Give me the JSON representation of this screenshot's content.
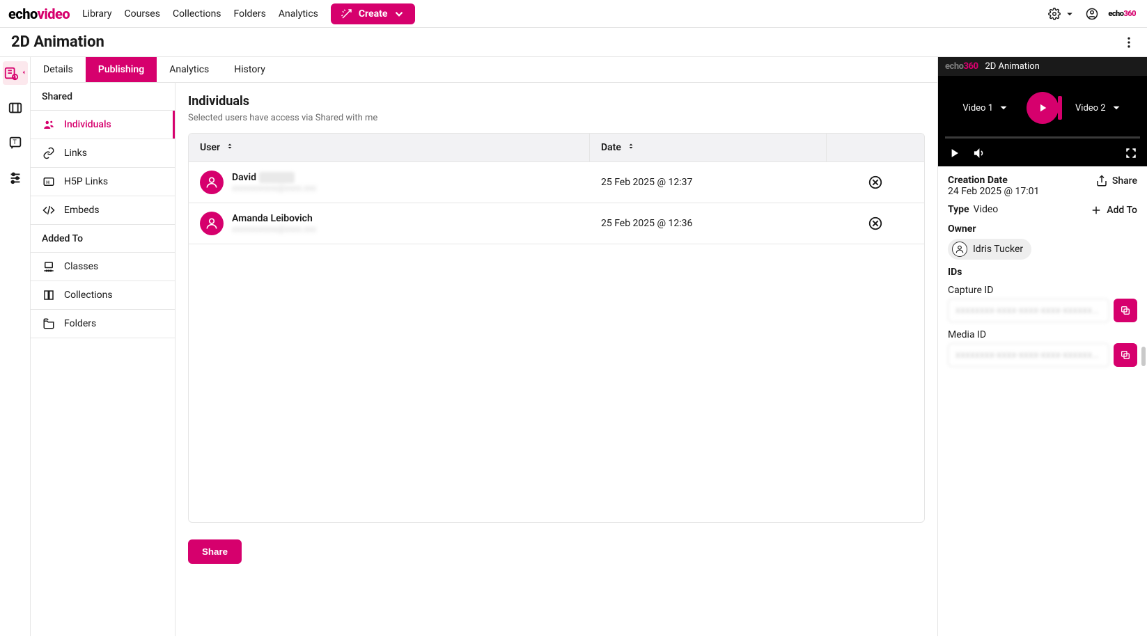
{
  "brand": {
    "part1": "echo",
    "part2": "video"
  },
  "nav": {
    "library": "Library",
    "courses": "Courses",
    "collections": "Collections",
    "folders": "Folders",
    "analytics": "Analytics",
    "create": "Create"
  },
  "page_title": "2D Animation",
  "tabs": {
    "details": "Details",
    "publishing": "Publishing",
    "analytics": "Analytics",
    "history": "History"
  },
  "subnav": {
    "shared_heading": "Shared",
    "individuals": "Individuals",
    "links": "Links",
    "h5p": "H5P Links",
    "embeds": "Embeds",
    "added_heading": "Added To",
    "classes": "Classes",
    "collections": "Collections",
    "folders": "Folders"
  },
  "main": {
    "heading": "Individuals",
    "subheading": "Selected users have access via Shared with me",
    "col_user": "User",
    "col_date": "Date",
    "rows": [
      {
        "name_first": "David",
        "name_rest": "Xxxxxx",
        "email": "xxxxxxxxxxx@xxxx.xxx",
        "date": "25 Feb 2025 @ 12:37"
      },
      {
        "name_first": "Amanda Leibovich",
        "name_rest": "",
        "email": "xxxxxxxxxxx@xxxx.xxx",
        "date": "25 Feb 2025 @ 12:36"
      }
    ],
    "share_button": "Share"
  },
  "detail": {
    "player_brand_a": "echo",
    "player_brand_b": "360",
    "player_title": "2D Animation",
    "video1": "Video 1",
    "video2": "Video 2",
    "creation_label": "Creation Date",
    "creation_value": "24 Feb 2025 @ 17:01",
    "share_action": "Share",
    "type_label": "Type",
    "type_value": "Video",
    "addto_action": "Add To",
    "owner_label": "Owner",
    "owner_name": "Idris Tucker",
    "ids_label": "IDs",
    "capture_label": "Capture ID",
    "capture_value": "xxxxxxxx-xxxx-xxxx-xxxx-xxxxxxxxxxxx",
    "media_label": "Media ID",
    "media_value": "xxxxxxxx-xxxx-xxxx-xxxx-xxxxxxxxxxxx"
  }
}
